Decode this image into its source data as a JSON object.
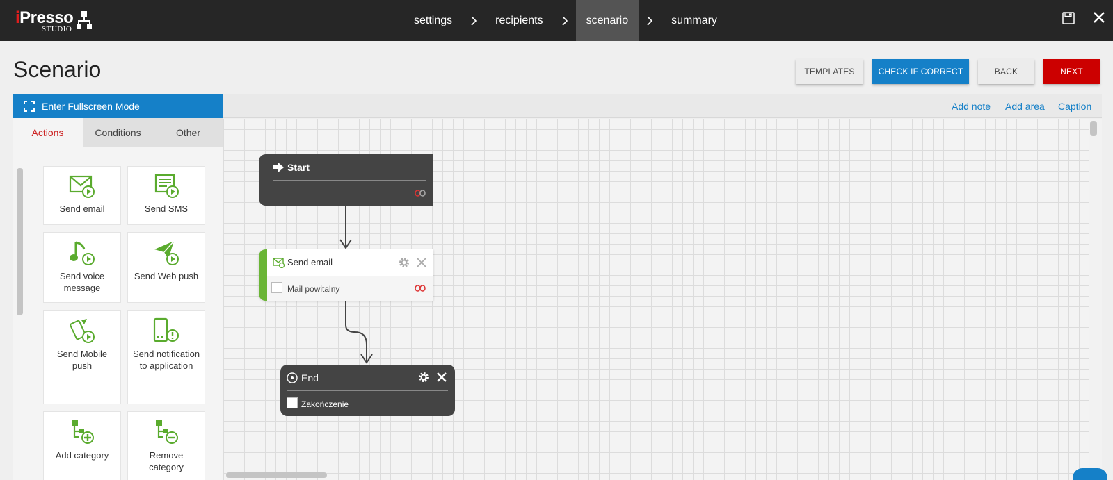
{
  "app": {
    "logo_brand_i": "i",
    "logo_brand_rest": "Presso",
    "logo_studio": "STUDIO"
  },
  "breadcrumbs": [
    {
      "label": "settings",
      "active": false
    },
    {
      "label": "recipients",
      "active": false
    },
    {
      "label": "scenario",
      "active": true
    },
    {
      "label": "summary",
      "active": false
    }
  ],
  "header": {
    "title": "Scenario",
    "templates_label": "TEMPLATES",
    "check_label": "CHECK IF CORRECT",
    "back_label": "BACK",
    "next_label": "NEXT"
  },
  "fullscreen": {
    "label": "Enter Fullscreen Mode"
  },
  "toolbar": {
    "add_note": "Add note",
    "add_area": "Add area",
    "caption": "Caption"
  },
  "tabs": [
    {
      "label": "Actions",
      "active": true
    },
    {
      "label": "Conditions",
      "active": false
    },
    {
      "label": "Other",
      "active": false
    }
  ],
  "tiles": [
    {
      "label": "Send email",
      "icon": "send-email-icon"
    },
    {
      "label": "Send SMS",
      "icon": "send-sms-icon"
    },
    {
      "label": "Send voice message",
      "icon": "voice-message-icon"
    },
    {
      "label": "Send Web push",
      "icon": "web-push-icon"
    },
    {
      "label": "Send Mobile push",
      "icon": "mobile-push-icon"
    },
    {
      "label": "Send notification to application",
      "icon": "app-notification-icon"
    },
    {
      "label": "Add category",
      "icon": "add-category-icon"
    },
    {
      "label": "Remove category",
      "icon": "remove-category-icon"
    }
  ],
  "nodes": {
    "start": {
      "title": "Start"
    },
    "email": {
      "title": "Send email",
      "subtitle": "Mail powitalny"
    },
    "end": {
      "title": "End",
      "subtitle": "Zakończenie"
    }
  },
  "colors": {
    "topbar": "#262626",
    "accent_blue": "#1580c8",
    "accent_red": "#cc0000",
    "action_green": "#6ab536",
    "node_dark": "#444444"
  }
}
